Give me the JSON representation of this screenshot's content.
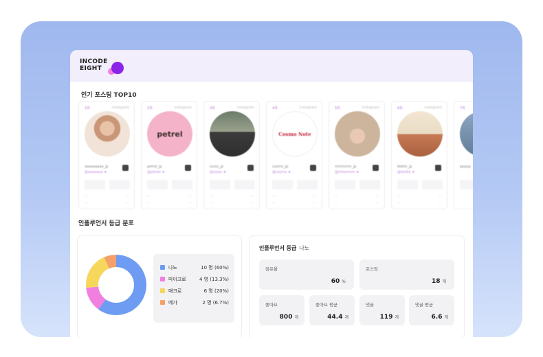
{
  "logo": {
    "line1": "INCODE",
    "line2": "EIGHT"
  },
  "sections": {
    "top_posts_title": "인기 포스팅 TOP10",
    "grade_title": "인플루언서 등급 분포"
  },
  "posts": [
    {
      "avatar_text": ""
    },
    {
      "avatar_text": "petrel"
    },
    {
      "avatar_text": ""
    },
    {
      "avatar_text": "Cosmo Note"
    },
    {
      "avatar_text": ""
    },
    {
      "avatar_text": ""
    },
    {
      "avatar_text": ""
    }
  ],
  "distribution": {
    "legend": [
      {
        "name": "나노",
        "value": "10 명 (60%)",
        "color": "#6e9cf2"
      },
      {
        "name": "마이크로",
        "value": "4 명 (13.3%)",
        "color": "#f07fe0"
      },
      {
        "name": "매크로",
        "value": "6 명 (20%)",
        "color": "#f7d65c"
      },
      {
        "name": "메가",
        "value": "2 명 (6.7%)",
        "color": "#f5a06a"
      }
    ],
    "donut_shares": [
      0.6,
      0.133,
      0.2,
      0.067
    ]
  },
  "grade_panel": {
    "title": "인플루언서 등급",
    "selected": "나노",
    "tiles": [
      {
        "label": "점유율",
        "value": "60",
        "unit": "%"
      },
      {
        "label": "포스팅",
        "value": "18",
        "unit": "개"
      },
      {
        "label": "좋아요",
        "value": "800",
        "unit": "개"
      },
      {
        "label": "좋아요 평균",
        "value": "44.4",
        "unit": "개"
      },
      {
        "label": "댓글",
        "value": "119",
        "unit": "개"
      },
      {
        "label": "댓글 평균",
        "value": "6.6",
        "unit": "개"
      }
    ]
  }
}
